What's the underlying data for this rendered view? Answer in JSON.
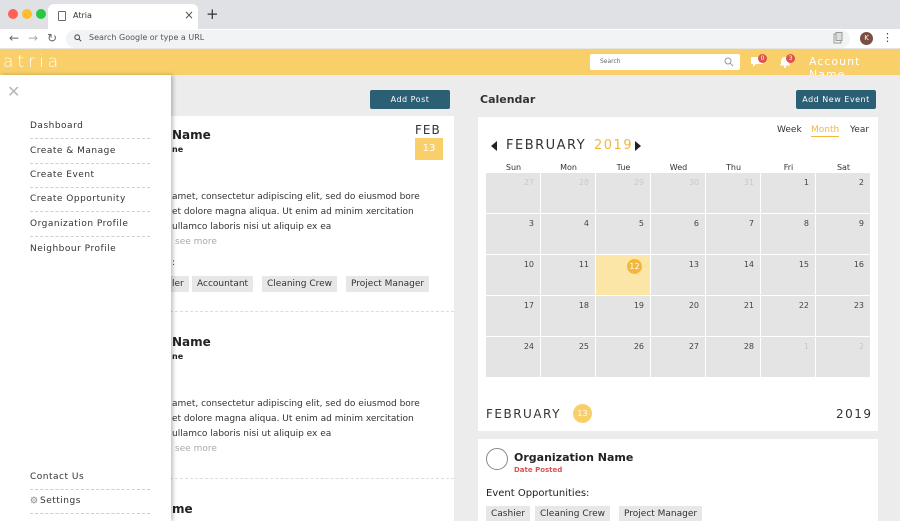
{
  "browser": {
    "tab_title": "Atria",
    "tab_close": "×",
    "new_tab": "+",
    "back": "←",
    "forward": "→",
    "reload": "↻",
    "address_placeholder": "Search Google or type a URL",
    "profile_initial": "K",
    "menu": "⋮",
    "traffic_colors": [
      "#fe5f57",
      "#febc2e",
      "#28c840"
    ]
  },
  "header": {
    "logo": "atria",
    "search_placeholder": "Search",
    "messages_badge": "0",
    "notifications_badge": "3",
    "account": "Account Name",
    "accent": "#f8cf68"
  },
  "sidebar": {
    "close": "✕",
    "items": [
      "Dashboard",
      "Create & Manage",
      "Create Event",
      "Create Opportunity",
      "Organization Profile",
      "Neighbour Profile"
    ],
    "footer": [
      "Contact Us",
      "Settings"
    ]
  },
  "feed": {
    "add_post_label": "Add Post",
    "posts": [
      {
        "name": "Name",
        "sub": "ne",
        "month": "FEB",
        "day": "13",
        "body": "amet, consectetur adipiscing elit, sed do eiusmod bore et dolore magna aliqua. Ut enim ad minim xercitation ullamco laboris nisi ut aliquip ex ea",
        "see_more": "see more",
        "colon": ":",
        "tags": [
          "ler",
          "Accountant",
          "Cleaning Crew",
          "Project Manager"
        ]
      },
      {
        "name": "Name",
        "sub": "ne",
        "body": "amet, consectetur adipiscing elit, sed do eiusmod bore et dolore magna aliqua. Ut enim ad minim xercitation ullamco laboris nisi ut aliquip ex ea",
        "see_more": "see more"
      },
      {
        "name": "me"
      }
    ]
  },
  "calendar": {
    "title": "Calendar",
    "add_event_label": "Add New Event",
    "views": [
      "Week",
      "Month",
      "Year"
    ],
    "active_view": "Month",
    "month": "FEBRUARY",
    "year": "2019",
    "weekdays": [
      "Sun",
      "Mon",
      "Tue",
      "Wed",
      "Thu",
      "Fri",
      "Sat"
    ],
    "weeks": [
      [
        "27",
        "28",
        "29",
        "30",
        "31",
        "1",
        "2"
      ],
      [
        "3",
        "4",
        "5",
        "6",
        "7",
        "8",
        "9"
      ],
      [
        "10",
        "11",
        "12",
        "13",
        "14",
        "15",
        "16"
      ],
      [
        "17",
        "18",
        "19",
        "20",
        "21",
        "22",
        "23"
      ],
      [
        "24",
        "25",
        "26",
        "27",
        "28",
        "1",
        "2"
      ]
    ],
    "today": "12"
  },
  "day_band": {
    "month": "FEBRUARY",
    "day": "13",
    "year": "2019"
  },
  "event": {
    "org_name": "Organization Name",
    "date_posted": "Date Posted",
    "opportunities_label": "Event Opportunities:",
    "tags": [
      "Cashier",
      "Cleaning Crew",
      "Project Manager"
    ]
  }
}
